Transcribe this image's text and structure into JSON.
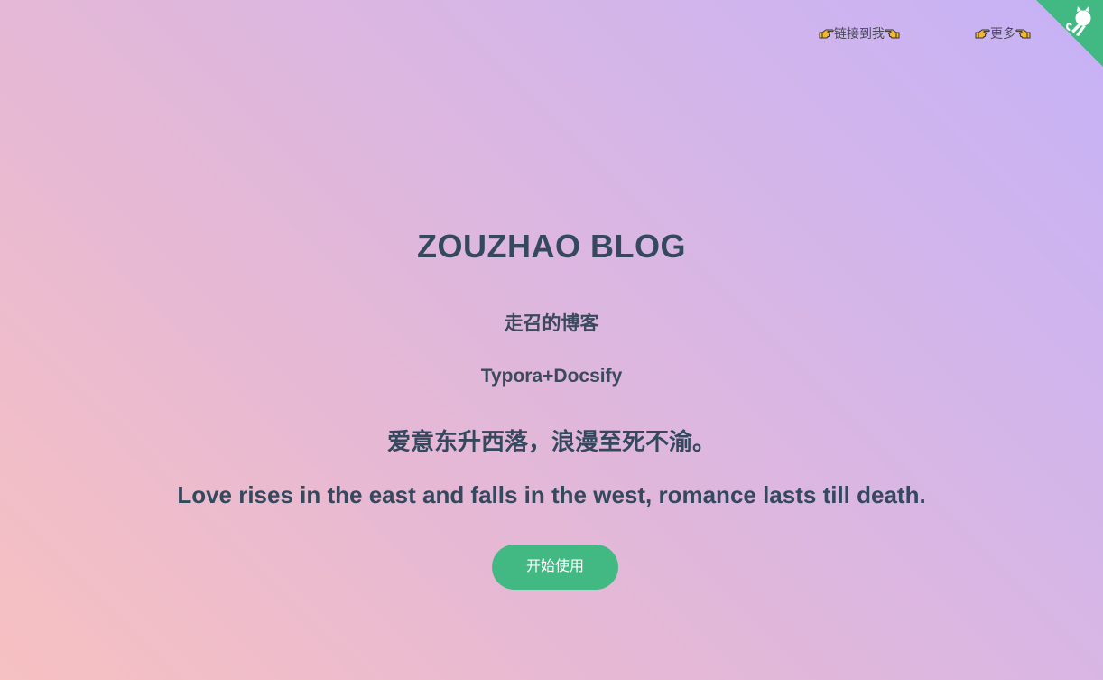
{
  "nav": {
    "links_label": "链接到我",
    "more_label": "更多"
  },
  "cover": {
    "title": "ZOUZHAO BLOG",
    "subtitle": "走召的博客",
    "tagline": "Typora+Docsify",
    "quote_cn": "爱意东升西落，浪漫至死不渝。",
    "quote_en": "Love rises in the east and falls in the west, romance lasts till death.",
    "start_button": "开始使用"
  },
  "icons": {
    "nav_left": "pointing-right-hand-icon",
    "nav_right": "pointing-left-hand-icon",
    "corner": "github-octocat-icon"
  },
  "colors": {
    "accent": "#42b983",
    "text": "#34495e",
    "gradient_start": "#f7c1c1",
    "gradient_end": "#c6b2f7"
  }
}
